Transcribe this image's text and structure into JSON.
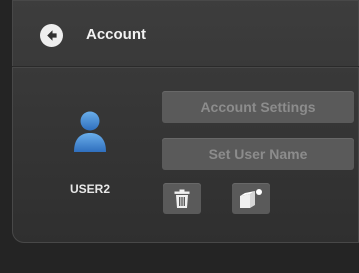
{
  "header": {
    "title": "Account",
    "back_icon": "arrow-left-circle-icon"
  },
  "user": {
    "name": "USER2",
    "avatar_icon": "user-avatar-icon"
  },
  "actions": {
    "account_settings_label": "Account Settings",
    "set_user_name_label": "Set User Name",
    "delete_icon": "trash-icon",
    "switch_icon": "switch-user-icon"
  },
  "colors": {
    "avatar_blue": "#3f86d4",
    "button_bg": "#5a5a5a",
    "button_text": "#8c8c8c"
  }
}
